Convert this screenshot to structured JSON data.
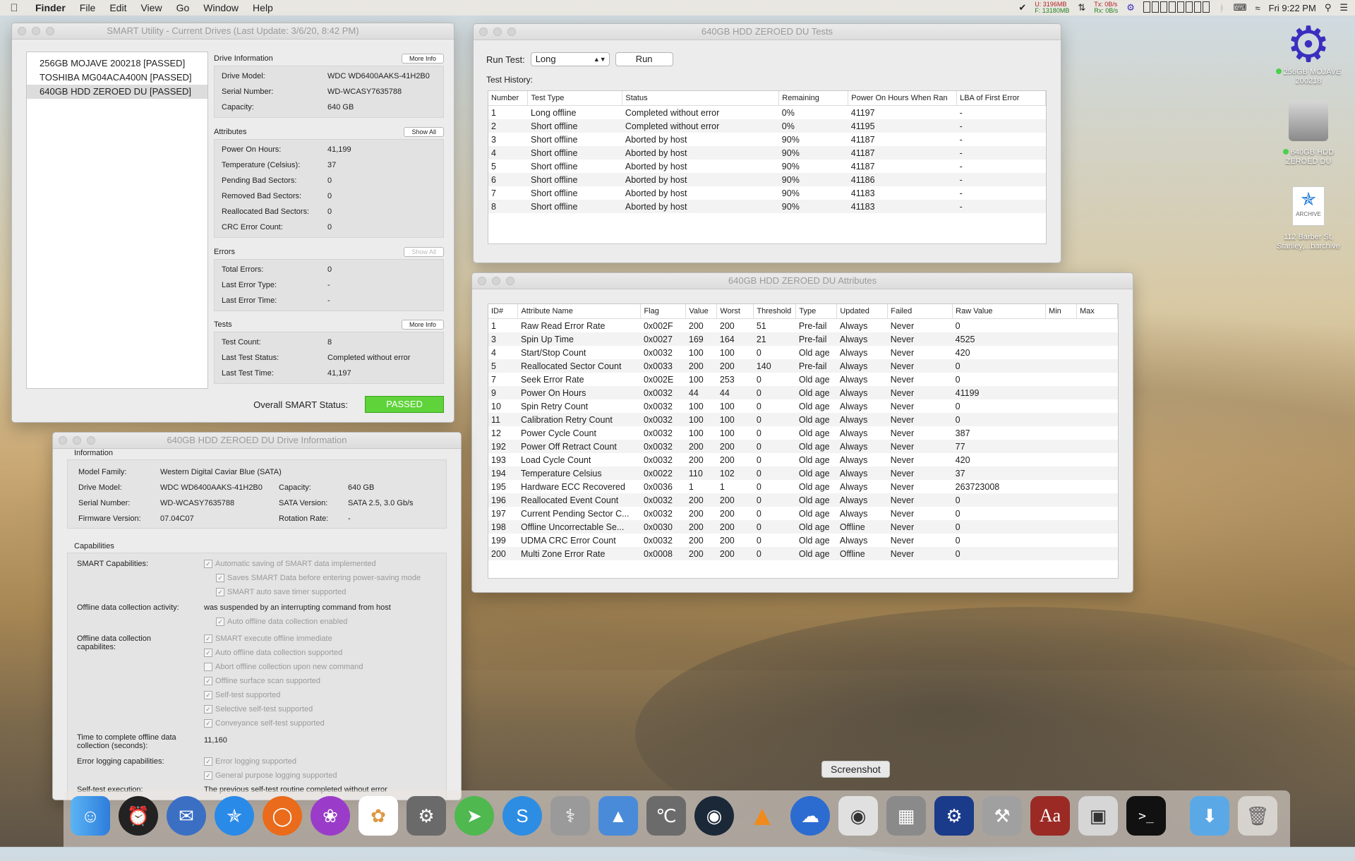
{
  "menubar": {
    "app": "Finder",
    "items": [
      "File",
      "Edit",
      "View",
      "Go",
      "Window",
      "Help"
    ],
    "netstat_u": "U: 3196MB",
    "netstat_f": "F: 13180MB",
    "tx": "Tx: 0B/s",
    "rx": "Rx: 0B/s",
    "clock": "Fri 9:22 PM"
  },
  "smart_window": {
    "title": "SMART Utility - Current Drives (Last Update: 3/6/20, 8:42 PM)",
    "drives": [
      "256GB MOJAVE 200218  [PASSED]",
      "TOSHIBA MG04ACA400N  [PASSED]",
      "640GB HDD ZEROED DU  [PASSED]"
    ],
    "drive_info": {
      "label": "Drive Information",
      "button": "More Info",
      "rows": [
        [
          "Drive Model:",
          "WDC WD6400AAKS-41H2B0"
        ],
        [
          "Serial Number:",
          "WD-WCASY7635788"
        ],
        [
          "Capacity:",
          "640 GB"
        ]
      ]
    },
    "attributes": {
      "label": "Attributes",
      "button": "Show All",
      "rows": [
        [
          "Power On Hours:",
          "41,199"
        ],
        [
          "Temperature (Celsius):",
          "37"
        ],
        [
          "Pending Bad Sectors:",
          "0"
        ],
        [
          "Removed Bad Sectors:",
          "0"
        ],
        [
          "Reallocated Bad Sectors:",
          "0"
        ],
        [
          "CRC Error Count:",
          "0"
        ]
      ]
    },
    "errors": {
      "label": "Errors",
      "button": "Show All",
      "rows": [
        [
          "Total Errors:",
          "0"
        ],
        [
          "Last Error Type:",
          "-"
        ],
        [
          "Last Error Time:",
          "-"
        ]
      ]
    },
    "tests": {
      "label": "Tests",
      "button": "More Info",
      "rows": [
        [
          "Test Count:",
          "8"
        ],
        [
          "Last Test Status:",
          "Completed without error"
        ],
        [
          "Last Test Time:",
          "41,197"
        ]
      ]
    },
    "overall_label": "Overall SMART Status:",
    "overall_value": "PASSED"
  },
  "tests_window": {
    "title": "640GB HDD ZEROED DU Tests",
    "run_label": "Run Test:",
    "run_value": "Long",
    "run_button": "Run",
    "history_label": "Test History:",
    "columns": [
      "Number",
      "Test Type",
      "Status",
      "Remaining",
      "Power On Hours When Ran",
      "LBA of First Error"
    ],
    "rows": [
      [
        "1",
        "Long offline",
        "Completed without error",
        "0%",
        "41197",
        "-"
      ],
      [
        "2",
        "Short offline",
        "Completed without error",
        "0%",
        "41195",
        "-"
      ],
      [
        "3",
        "Short offline",
        "Aborted by host",
        "90%",
        "41187",
        "-"
      ],
      [
        "4",
        "Short offline",
        "Aborted by host",
        "90%",
        "41187",
        "-"
      ],
      [
        "5",
        "Short offline",
        "Aborted by host",
        "90%",
        "41187",
        "-"
      ],
      [
        "6",
        "Short offline",
        "Aborted by host",
        "90%",
        "41186",
        "-"
      ],
      [
        "7",
        "Short offline",
        "Aborted by host",
        "90%",
        "41183",
        "-"
      ],
      [
        "8",
        "Short offline",
        "Aborted by host",
        "90%",
        "41183",
        "-"
      ]
    ]
  },
  "attrs_window": {
    "title": "640GB HDD ZEROED DU Attributes",
    "columns": [
      "ID#",
      "Attribute Name",
      "Flag",
      "Value",
      "Worst",
      "Threshold",
      "Type",
      "Updated",
      "Failed",
      "Raw Value",
      "Min",
      "Max"
    ],
    "rows": [
      [
        "1",
        "Raw Read Error Rate",
        "0x002F",
        "200",
        "200",
        "51",
        "Pre-fail",
        "Always",
        "Never",
        "0",
        "",
        ""
      ],
      [
        "3",
        "Spin Up Time",
        "0x0027",
        "169",
        "164",
        "21",
        "Pre-fail",
        "Always",
        "Never",
        "4525",
        "",
        ""
      ],
      [
        "4",
        "Start/Stop Count",
        "0x0032",
        "100",
        "100",
        "0",
        "Old age",
        "Always",
        "Never",
        "420",
        "",
        ""
      ],
      [
        "5",
        "Reallocated Sector Count",
        "0x0033",
        "200",
        "200",
        "140",
        "Pre-fail",
        "Always",
        "Never",
        "0",
        "",
        ""
      ],
      [
        "7",
        "Seek Error Rate",
        "0x002E",
        "100",
        "253",
        "0",
        "Old age",
        "Always",
        "Never",
        "0",
        "",
        ""
      ],
      [
        "9",
        "Power On Hours",
        "0x0032",
        "44",
        "44",
        "0",
        "Old age",
        "Always",
        "Never",
        "41199",
        "",
        ""
      ],
      [
        "10",
        "Spin Retry Count",
        "0x0032",
        "100",
        "100",
        "0",
        "Old age",
        "Always",
        "Never",
        "0",
        "",
        ""
      ],
      [
        "11",
        "Calibration Retry Count",
        "0x0032",
        "100",
        "100",
        "0",
        "Old age",
        "Always",
        "Never",
        "0",
        "",
        ""
      ],
      [
        "12",
        "Power Cycle Count",
        "0x0032",
        "100",
        "100",
        "0",
        "Old age",
        "Always",
        "Never",
        "387",
        "",
        ""
      ],
      [
        "192",
        "Power Off Retract Count",
        "0x0032",
        "200",
        "200",
        "0",
        "Old age",
        "Always",
        "Never",
        "77",
        "",
        ""
      ],
      [
        "193",
        "Load Cycle Count",
        "0x0032",
        "200",
        "200",
        "0",
        "Old age",
        "Always",
        "Never",
        "420",
        "",
        ""
      ],
      [
        "194",
        "Temperature Celsius",
        "0x0022",
        "110",
        "102",
        "0",
        "Old age",
        "Always",
        "Never",
        "37",
        "",
        ""
      ],
      [
        "195",
        "Hardware ECC Recovered",
        "0x0036",
        "1",
        "1",
        "0",
        "Old age",
        "Always",
        "Never",
        "263723008",
        "",
        ""
      ],
      [
        "196",
        "Reallocated Event Count",
        "0x0032",
        "200",
        "200",
        "0",
        "Old age",
        "Always",
        "Never",
        "0",
        "",
        ""
      ],
      [
        "197",
        "Current Pending Sector C...",
        "0x0032",
        "200",
        "200",
        "0",
        "Old age",
        "Always",
        "Never",
        "0",
        "",
        ""
      ],
      [
        "198",
        "Offline Uncorrectable Se...",
        "0x0030",
        "200",
        "200",
        "0",
        "Old age",
        "Offline",
        "Never",
        "0",
        "",
        ""
      ],
      [
        "199",
        "UDMA CRC Error Count",
        "0x0032",
        "200",
        "200",
        "0",
        "Old age",
        "Always",
        "Never",
        "0",
        "",
        ""
      ],
      [
        "200",
        "Multi Zone Error Rate",
        "0x0008",
        "200",
        "200",
        "0",
        "Old age",
        "Offline",
        "Never",
        "0",
        "",
        ""
      ]
    ]
  },
  "info_window": {
    "title": "640GB HDD ZEROED DU Drive Information",
    "information_label": "Information",
    "model_family_k": "Model Family:",
    "model_family_v": "Western Digital Caviar Blue (SATA)",
    "drive_model_k": "Drive Model:",
    "drive_model_v": "WDC WD6400AAKS-41H2B0",
    "serial_k": "Serial Number:",
    "serial_v": "WD-WCASY7635788",
    "firmware_k": "Firmware Version:",
    "firmware_v": "07.04C07",
    "capacity_k": "Capacity:",
    "capacity_v": "640 GB",
    "sata_k": "SATA Version:",
    "sata_v": "SATA 2.5, 3.0 Gb/s",
    "rotation_k": "Rotation Rate:",
    "rotation_v": "-",
    "capabilities_label": "Capabilities",
    "smart_cap_label": "SMART Capabilities:",
    "smart_caps": [
      "Automatic saving of SMART data implemented",
      "Saves SMART Data before entering power-saving mode",
      "SMART auto save timer supported"
    ],
    "offline_activity_label": "Offline data collection activity:",
    "offline_activity_value": "was suspended by an interrupting command from host",
    "auto_offline_enabled": "Auto offline data collection enabled",
    "offline_caps_label": "Offline data collection capabilites:",
    "offline_caps": [
      "SMART execute offline immediate",
      "Auto offline data collection supported",
      "Abort offline collection upon new command",
      "Offline surface scan supported",
      "Self-test supported",
      "Selective self-test supported",
      "Conveyance self-test supported"
    ],
    "time_label": "Time to complete offline data collection (seconds):",
    "time_value": "11,160",
    "error_log_label": "Error logging capabilities:",
    "error_log_caps": [
      "Error logging supported",
      "General purpose logging supported"
    ],
    "selftest_label": "Self-test execution:",
    "selftest_value": "The previous self-test routine completed without error"
  },
  "desktop": {
    "icon1": "256GB MOJAVE 200218",
    "icon2": "640GB HDD ZEROED DU",
    "archive_tag": "ARCHIVE",
    "icon3": "112 Barber St, Stanley,...barchive"
  },
  "tooltip": "Screenshot"
}
